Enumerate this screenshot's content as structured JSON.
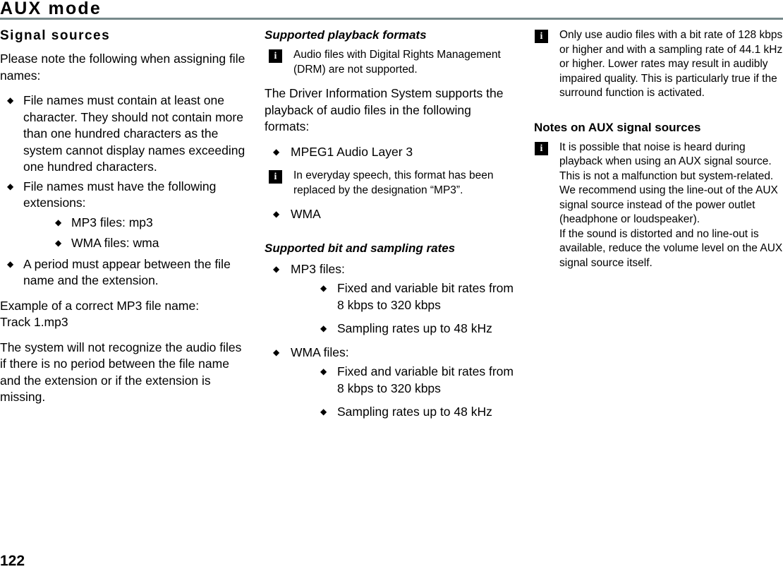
{
  "header": {
    "title": "AUX mode"
  },
  "footer": {
    "page_number": "122"
  },
  "icons": {
    "info": "i"
  },
  "bullets": {
    "diamond": "◆"
  },
  "column1": {
    "heading": "Signal sources",
    "intro": "Please note the following when assigning file names:",
    "bullets": [
      "File names must contain at least one character. They should not contain more than one hundred characters as the system cannot display names exceeding one hundred characters.",
      "File names must have the following extensions:"
    ],
    "extension_bullets": [
      "MP3 files: mp3",
      "WMA files: wma"
    ],
    "bullet_last": "A period must appear between the file name and the extension.",
    "example_line1": "Example of a correct MP3 file name:",
    "example_line2": "Track 1.mp3",
    "closing": "The system will not recognize the audio files if there is no period between the file name and the extension or if the extension is missing."
  },
  "column2": {
    "heading_formats": "Supported playback formats",
    "note_drm": "Audio files with Digital Rights Management (DRM) are not supported.",
    "intro_formats": "The Driver Information System supports the playback of audio files in the following formats:",
    "format_bullet_1": "MPEG1 Audio Layer 3",
    "note_mp3": "In everyday speech, this format has been replaced by the designation “MP3”.",
    "format_bullet_2": "WMA",
    "heading_rates": "Supported bit and sampling rates",
    "rates": [
      {
        "label": "MP3 files:",
        "items": [
          "Fixed and variable bit rates from 8 kbps to 320 kbps",
          "Sampling rates up to 48 kHz"
        ]
      },
      {
        "label": "WMA files:",
        "items": [
          "Fixed and variable bit rates from 8 kbps to 320 kbps",
          "Sampling rates up to 48 kHz"
        ]
      }
    ]
  },
  "column3": {
    "note_bitrate": "Only use audio files with a bit rate of 128 kbps or higher and with a sampling rate of 44.1 kHz or higher. Lower rates may result in audibly impaired quality. This is particularly true if the surround function is activated.",
    "heading_notes": "Notes on AUX signal sources",
    "note_aux": "It is possible that noise is heard during playback when using an AUX signal source. This is not a malfunction but system-related. We recommend using the line-out of the AUX signal source instead of the power outlet (headphone or loudspeaker).\nIf the sound is distorted and no line-out is available, reduce the volume level on the AUX signal source itself."
  },
  "colors": {
    "rule": "#77898b",
    "text": "#000000",
    "icon_background": "#000000",
    "icon_foreground": "#ffffff"
  }
}
